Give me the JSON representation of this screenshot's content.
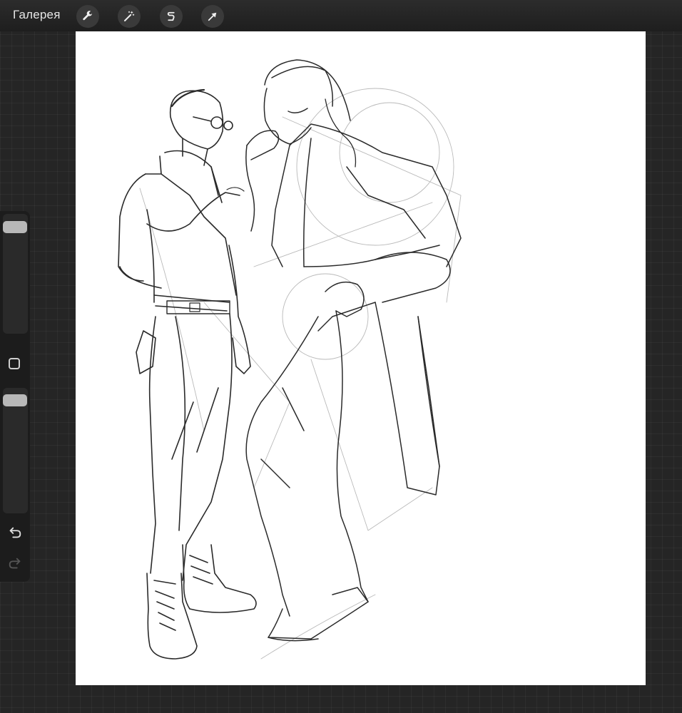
{
  "toolbar": {
    "gallery_label": "Галерея",
    "tools": [
      "wrench-icon",
      "magic-wand-icon",
      "selection-s-icon",
      "move-arrow-icon"
    ]
  },
  "sidebar": {
    "brush_size_level": 0.05,
    "opacity_level": 0.05,
    "controls": [
      "modify-square-icon",
      "undo-icon",
      "redo-icon"
    ]
  },
  "colors": {
    "background": "#252525",
    "canvas": "#ffffff",
    "sketch_line": "#2a2a2a"
  }
}
